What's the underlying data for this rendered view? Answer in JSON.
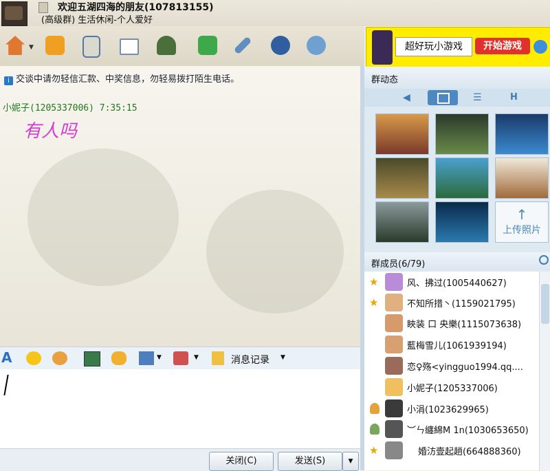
{
  "window": {
    "title": "欢迎五湖四海的朋友(107813155)",
    "subtitle": "(高级群) 生活休闲-个人爱好"
  },
  "toolbar": {
    "icons": [
      "home-icon",
      "folder-icon",
      "notes-icon",
      "card-icon",
      "tree-icon",
      "add-app-icon",
      "tools-icon",
      "music-icon",
      "settings-icon"
    ]
  },
  "ad": {
    "text": "超好玩小游戏",
    "button": "开始游戏"
  },
  "chat": {
    "notice": "交谈中请勿轻信汇款、中奖信息，勿轻易拨打陌生电话。",
    "messages": [
      {
        "header": "小妮子(1205337006)  7:35:15",
        "text": "有人吗"
      }
    ]
  },
  "input": {
    "history_label": "消息记录"
  },
  "buttons": {
    "close": "关闭(C)",
    "send": "发送(S)"
  },
  "group_dynamic": {
    "title": "群动态",
    "upload_label": "上传照片",
    "tab_h": "H"
  },
  "members": {
    "title": "群成员(6/79)",
    "list": [
      {
        "name": "风、拂过(1005440627)",
        "marker": "star"
      },
      {
        "name": "不知所措丶(1159021795)",
        "marker": "star"
      },
      {
        "name": "䀹装 口 央樂(1115073638)",
        "marker": ""
      },
      {
        "name": "藍梅雪儿(1061939194)",
        "marker": ""
      },
      {
        "name": "恋♀殇<yingguo1994.qq....",
        "marker": ""
      },
      {
        "name": "小妮子(1205337006)",
        "marker": ""
      },
      {
        "name": "小涓(1023629965)",
        "marker": "person"
      },
      {
        "name": "︶ㄣ纏綿M 1n(1030653650)",
        "marker": "person"
      },
      {
        "name": "婚汸壹起趟(664888360)",
        "marker": "star"
      }
    ]
  }
}
